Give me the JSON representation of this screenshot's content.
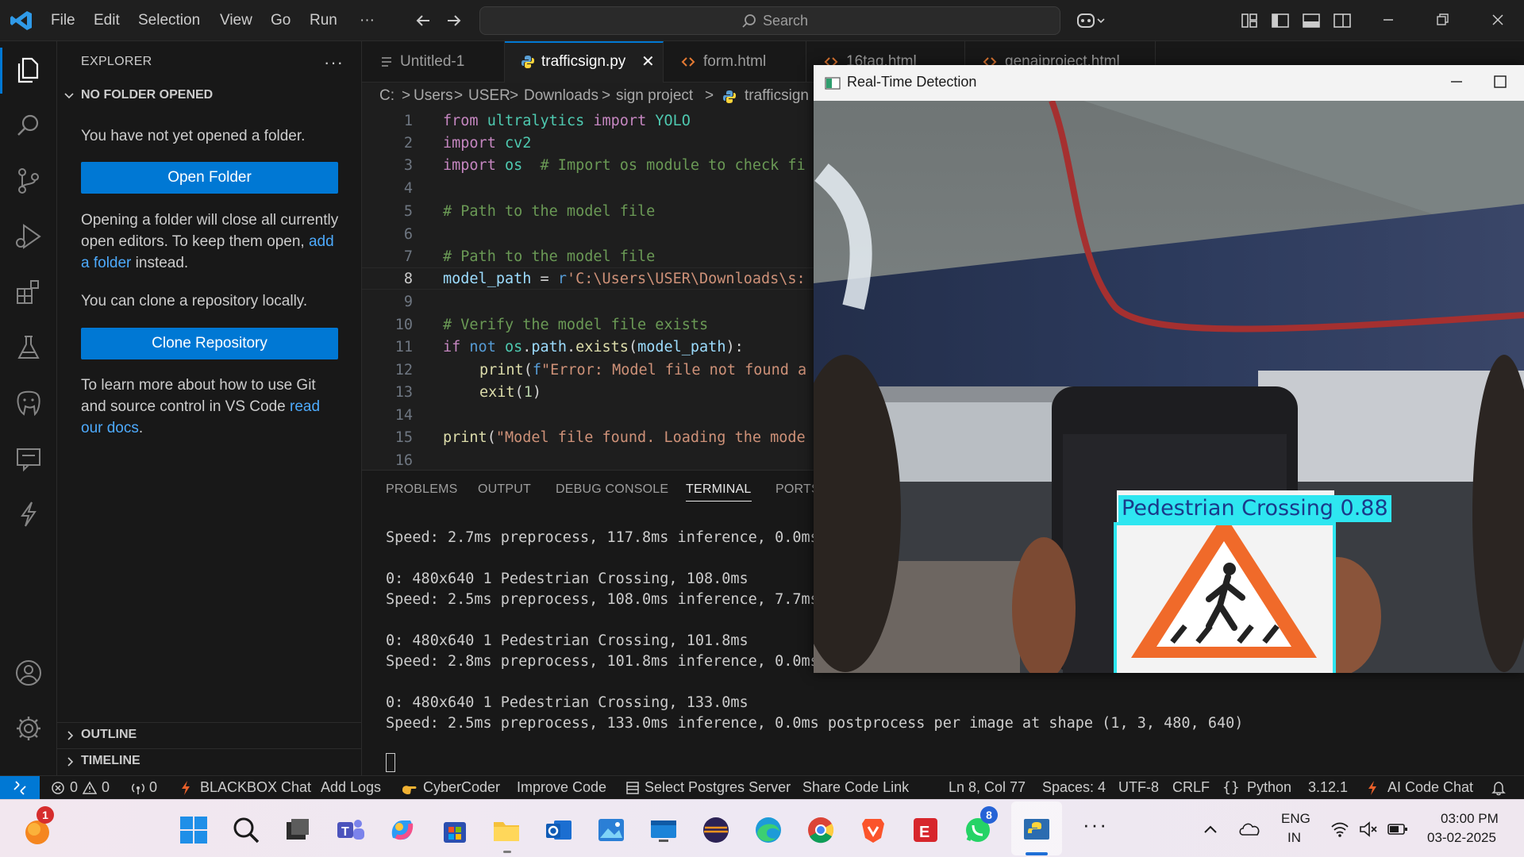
{
  "titlebar": {
    "menus": [
      "File",
      "Edit",
      "Selection",
      "View",
      "Go",
      "Run",
      "···"
    ],
    "search_placeholder": "Search"
  },
  "sidebar": {
    "title": "EXPLORER",
    "more": "···",
    "section": "NO FOLDER OPENED",
    "no_folder_text": "You have not yet opened a folder.",
    "open_folder_button": "Open Folder",
    "open_note_pre": "Opening a folder will close all currently open editors. To keep them open, ",
    "open_note_link": "add a folder",
    "open_note_post": " instead.",
    "clone_text": "You can clone a repository locally.",
    "clone_button": "Clone Repository",
    "git_note_pre": "To learn more about how to use Git and source control in VS Code ",
    "git_note_link": "read our docs",
    "git_note_post": ".",
    "outline": "OUTLINE",
    "timeline": "TIMELINE"
  },
  "tabs": [
    {
      "label": "Untitled-1",
      "icon": "menu-lines-icon"
    },
    {
      "label": "trafficsign.py",
      "icon": "python-icon",
      "active": true,
      "close": "✕"
    },
    {
      "label": "form.html",
      "icon": "html-icon"
    },
    {
      "label": "16tag.html",
      "icon": "html-icon"
    },
    {
      "label": "genaiproject.html",
      "icon": "html-icon"
    }
  ],
  "breadcrumb": [
    "C:",
    ">",
    "Users",
    ">",
    "USER",
    ">",
    "Downloads",
    ">",
    "sign project",
    ">",
    "trafficsign"
  ],
  "code": {
    "line_numbers": [
      "1",
      "2",
      "3",
      "4",
      "5",
      "6",
      "7",
      "8",
      "9",
      "10",
      "11",
      "12",
      "13",
      "14",
      "15",
      "16"
    ],
    "l1": [
      "from",
      "ultralytics",
      "import",
      "YOLO"
    ],
    "l2": [
      "import",
      "cv2"
    ],
    "l3": [
      "import",
      "os",
      "# Import os module to check fi"
    ],
    "l5": "# Path to the model file",
    "l7": "# Path to the model file",
    "l8": [
      "model_path",
      "=",
      "r",
      "'C:\\Users\\USER\\Downloads\\s:"
    ],
    "l10": "# Verify the model file exists",
    "l11": [
      "if",
      "not",
      "os",
      ".",
      "path",
      ".",
      "exists",
      "(",
      "model_path",
      "):"
    ],
    "l12": [
      "print",
      "(",
      "f",
      "\"Error: Model file not found a"
    ],
    "l13": [
      "exit",
      "(",
      "1",
      ")"
    ],
    "l15": [
      "print",
      "(",
      "\"Model file found. Loading the mode"
    ]
  },
  "panel": {
    "tabs": [
      "PROBLEMS",
      "OUTPUT",
      "DEBUG CONSOLE",
      "TERMINAL",
      "PORTS"
    ],
    "terminal_lines": [
      "Speed: 2.7ms preprocess, 117.8ms inference, 0.0ms",
      "0: 480x640 1 Pedestrian Crossing, 108.0ms",
      "Speed: 2.5ms preprocess, 108.0ms inference, 7.7ms",
      "0: 480x640 1 Pedestrian Crossing, 101.8ms",
      "Speed: 2.8ms preprocess, 101.8ms inference, 0.0ms",
      "0: 480x640 1 Pedestrian Crossing, 133.0ms",
      "Speed: 2.5ms preprocess, 133.0ms inference, 0.0ms postprocess per image at shape (1, 3, 480, 640)"
    ]
  },
  "detection_window": {
    "title": "Real-Time Detection",
    "label": "Pedestrian Crossing 0.88",
    "box_color": "#2ee6f0"
  },
  "statusbar": {
    "errors": "0",
    "warnings": "0",
    "ports": "0",
    "items_left": [
      "BLACKBOX Chat",
      "Add Logs",
      "CyberCoder",
      "Improve Code",
      "Select Postgres Server",
      "Share Code Link"
    ],
    "position": "Ln 8, Col 77",
    "spaces": "Spaces: 4",
    "encoding": "UTF-8",
    "eol": "CRLF",
    "language": "Python",
    "version": "3.12.1",
    "ai_chat": "AI Code Chat"
  },
  "taskbar": {
    "badge_weather": "1",
    "badge_whatsapp": "8",
    "lang_top": "ENG",
    "lang_bottom": "IN",
    "time": "03:00 PM",
    "date": "03-02-2025"
  },
  "colors": {
    "accent": "#0078d4",
    "background": "#1e1e1e",
    "sidebar": "#181818"
  }
}
